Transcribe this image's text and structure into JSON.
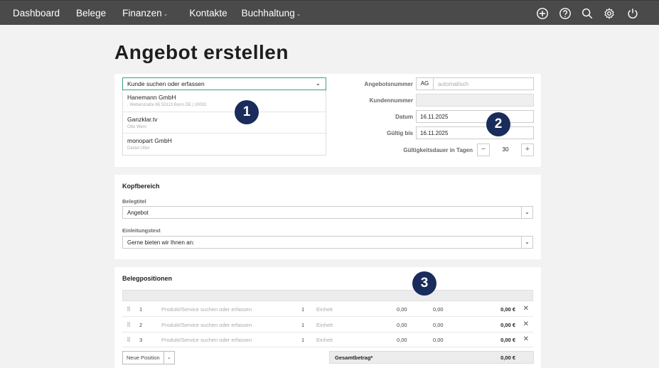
{
  "nav": {
    "items": [
      {
        "label": "Dashboard",
        "has_caret": false
      },
      {
        "label": "Belege",
        "has_caret": false
      },
      {
        "label": "Finanzen",
        "has_caret": true
      },
      {
        "label": "Kontakte",
        "has_caret": false
      },
      {
        "label": "Buchhaltung",
        "has_caret": true
      }
    ],
    "icons": [
      "plus-circle-icon",
      "help-icon",
      "search-icon",
      "gear-icon",
      "power-icon"
    ]
  },
  "page": {
    "title": "Angebot erstellen"
  },
  "customer": {
    "select_label": "Kunde suchen oder erfassen",
    "options": [
      {
        "name": "Hanemann GmbH",
        "sub": ", Weberstraße 65 53113 Bonn DE | 10002"
      },
      {
        "name": "Ganzklar.tv",
        "sub": "Otto Wern"
      },
      {
        "name": "monopart GmbH",
        "sub": "Daniel Utter"
      }
    ]
  },
  "meta": {
    "offer_number_label": "Angebotsnummer",
    "offer_prefix": "AG",
    "offer_placeholder": "automatisch",
    "customer_number_label": "Kundennummer",
    "customer_number_value": "",
    "date_label": "Datum",
    "date_value": "16.11.2025",
    "valid_until_label": "Gültig bis",
    "valid_until_value": "16.11.2025",
    "validity_label": "Gültigkeitsdauer in Tagen",
    "validity_value": "30",
    "minus": "−",
    "plus": "+"
  },
  "badges": {
    "one": "1",
    "two": "2",
    "three": "3"
  },
  "header_section": {
    "title": "Kopfbereich",
    "doc_title_label": "Belegtitel",
    "doc_title_value": "Angebot",
    "intro_label": "Einleitungstext",
    "intro_value": "Gerne bieten wir Ihnen an:"
  },
  "positions": {
    "title": "Belegpositionen",
    "rows": [
      {
        "num": "1",
        "product": "Produkt/Service suchen oder erfassen",
        "qty": "1",
        "unit": "Einheit",
        "price": "0,00",
        "discount": "0,00",
        "total": "0,00 €"
      },
      {
        "num": "2",
        "product": "Produkt/Service suchen oder erfassen",
        "qty": "1",
        "unit": "Einheit",
        "price": "0,00",
        "discount": "0,00",
        "total": "0,00 €"
      },
      {
        "num": "3",
        "product": "Produkt/Service suchen oder erfassen",
        "qty": "1",
        "unit": "Einheit",
        "price": "0,00",
        "discount": "0,00",
        "total": "0,00 €"
      }
    ],
    "new_position_label": "Neue Position",
    "total_label": "Gesamtbetrag*",
    "total_value": "0,00 €"
  },
  "colors": {
    "nav_bg": "#4a4a4a",
    "badge_bg": "#1a2c5b",
    "focus_border": "#3aa08a"
  }
}
